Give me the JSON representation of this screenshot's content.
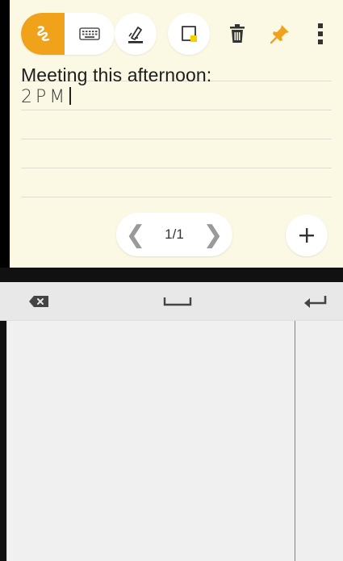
{
  "toolbar": {
    "handwriting_mode_icon": "handwriting-icon",
    "keyboard_mode_icon": "keyboard-icon",
    "highlighter_icon": "highlighter-icon",
    "color_icon": "note-color-icon",
    "delete_icon": "trash-icon",
    "pin_icon": "pin-icon",
    "more_icon": "more-vert-icon",
    "accent_color": "#f0a21a",
    "pin_color": "#f0a21a",
    "color_swatch": "#f6d000"
  },
  "note": {
    "title": "Meeting this afternoon:",
    "handwritten_text": "2PM",
    "background": "#fbf9e4"
  },
  "pager": {
    "prev_glyph": "❮",
    "page_label": "1/1",
    "next_glyph": "❯"
  },
  "add_page": {
    "icon": "plus-icon",
    "glyph": "+"
  },
  "handwriting_panel": {
    "backspace_icon": "backspace-icon",
    "space_icon": "space-icon",
    "enter_icon": "enter-icon",
    "guide_line_color": "#e0603a"
  }
}
